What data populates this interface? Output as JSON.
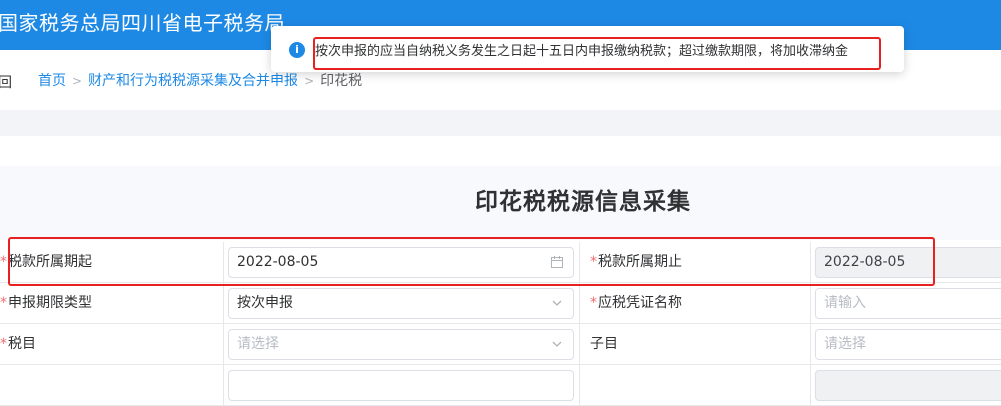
{
  "header": {
    "site_title": "国家税务总局四川省电子税务局"
  },
  "notice": {
    "icon": "info-icon",
    "text": "按次申报的应当自纳税义务发生之日起十五日内申报缴纳税款；超过缴款期限，将加收滞纳金"
  },
  "breadcrumb": {
    "back_label": "回",
    "items": [
      "首页",
      "财产和行为税税源采集及合并申报",
      "印花税"
    ]
  },
  "form": {
    "title": "印花税税源信息采集",
    "rows": [
      {
        "left_label": "税款所属期起",
        "left_required": true,
        "left_value": "2022-08-05",
        "left_suffix_icon": "calendar-icon",
        "right_label": "税款所属期止",
        "right_required": true,
        "right_value": "2022-08-05"
      },
      {
        "left_label": "申报期限类型",
        "left_required": true,
        "left_value": "按次申报",
        "left_suffix_icon": "chevron-down-icon",
        "right_label": "应税凭证名称",
        "right_required": true,
        "right_placeholder": "请输入"
      },
      {
        "left_label": "税目",
        "left_required": true,
        "left_placeholder": "请选择",
        "left_suffix_icon": "chevron-down-icon",
        "right_label": "子目",
        "right_required": false,
        "right_placeholder": "请选择"
      }
    ]
  },
  "colors": {
    "brand_blue": "#1d89e5",
    "required_red": "#f56c6c",
    "highlight_red": "#e8201f"
  }
}
